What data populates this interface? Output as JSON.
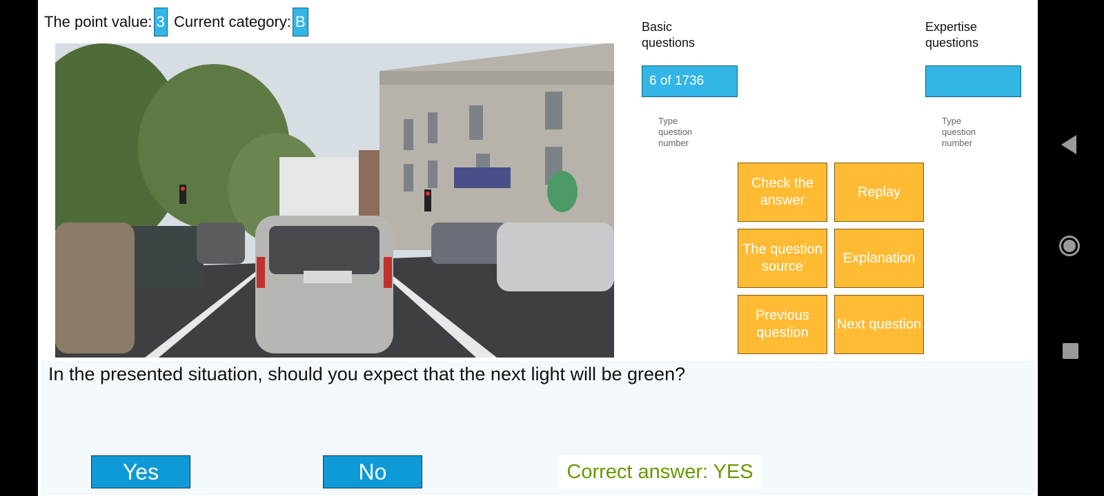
{
  "header": {
    "point_value_label": "The point value:",
    "point_value": "3",
    "category_label": "Current category:",
    "category": "B"
  },
  "basic": {
    "label": "Basic questions",
    "counter": "6 of 1736",
    "hint": "Type question number"
  },
  "expertise": {
    "label": "Expertise questions",
    "counter": "",
    "hint": "Type question number"
  },
  "buttons": {
    "check": "Check the answer",
    "replay": "Replay",
    "source": "The question source",
    "explanation": "Explanation",
    "previous": "Previous question",
    "next": "Next question"
  },
  "question": {
    "text": "In the presented situation, should you expect that the next light will be green?"
  },
  "answers": {
    "yes": "Yes",
    "no": "No",
    "correct": "Correct answer: YES"
  },
  "colors": {
    "badge": "#33b5e5",
    "button_orange": "#ffbb33",
    "answer_blue": "#0e9ad6",
    "correct_green": "#669900"
  },
  "icons": {
    "nav_back": "back-triangle-icon",
    "nav_home": "home-circle-icon",
    "nav_recent": "recent-apps-square-icon"
  }
}
